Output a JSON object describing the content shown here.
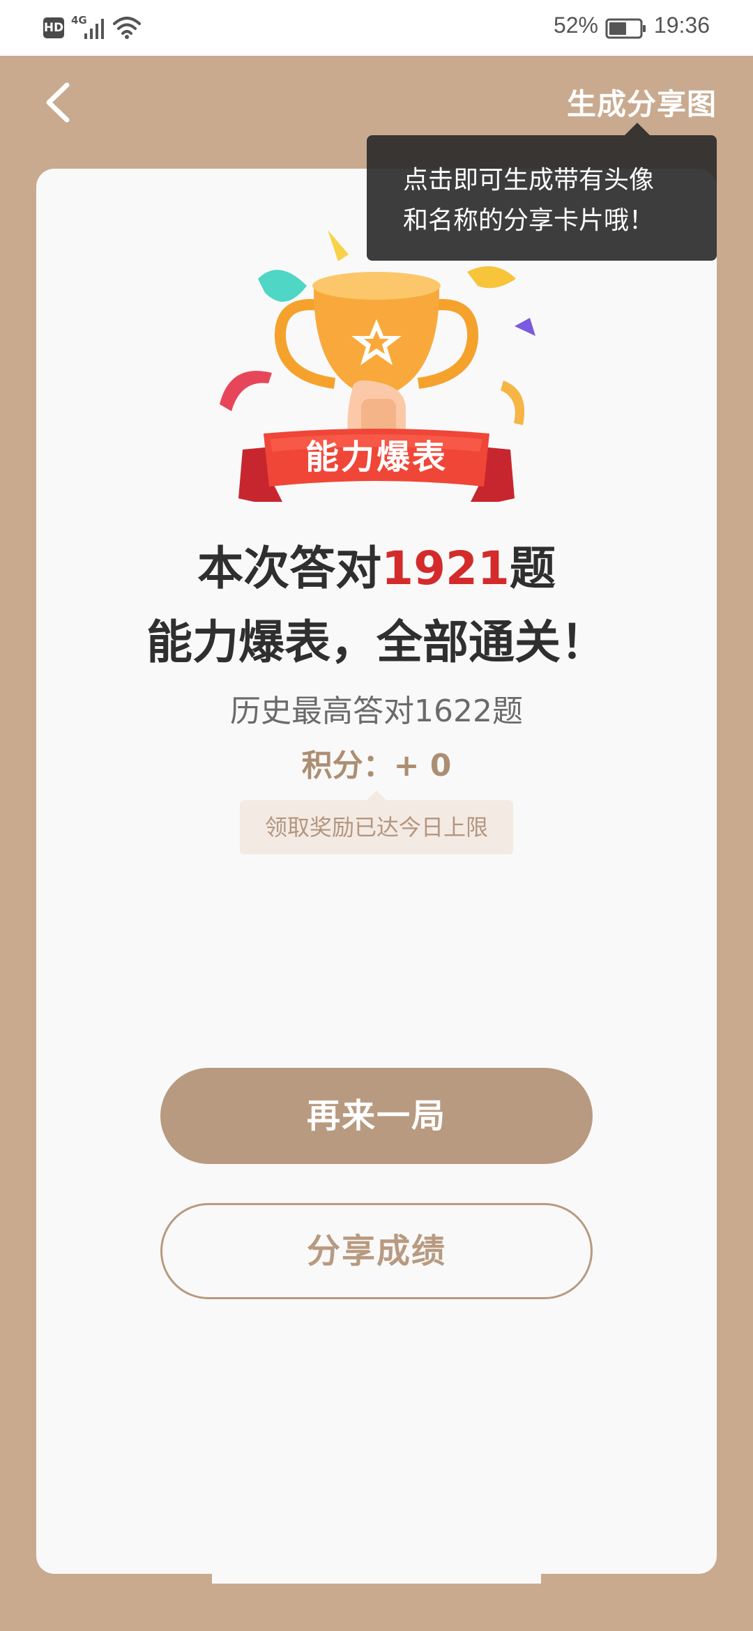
{
  "status_bar": {
    "hd": "HD",
    "network": "4G",
    "battery_percent": "52%",
    "time": "19:36"
  },
  "header": {
    "back_icon": "chevron-left-icon",
    "share_image_label": "生成分享图"
  },
  "tooltip": {
    "line1": "点击即可生成带有头像",
    "line2": "和名称的分享卡片哦！"
  },
  "result": {
    "badge_label": "能力爆表",
    "headline_prefix": "本次答对",
    "correct_count": "1921",
    "headline_suffix": "题",
    "headline_line2": "能力爆表，全部通关！",
    "history_best": "历史最高答对1622题",
    "points": "积分：+ 0",
    "reward_note": "领取奖励已达今日上限"
  },
  "buttons": {
    "play_again": "再来一局",
    "share_score": "分享成绩"
  },
  "colors": {
    "page_background": "#c9aa8f",
    "accent": "#b89a80",
    "score_red": "#d32b2b",
    "tooltip_bg": "#282828"
  }
}
